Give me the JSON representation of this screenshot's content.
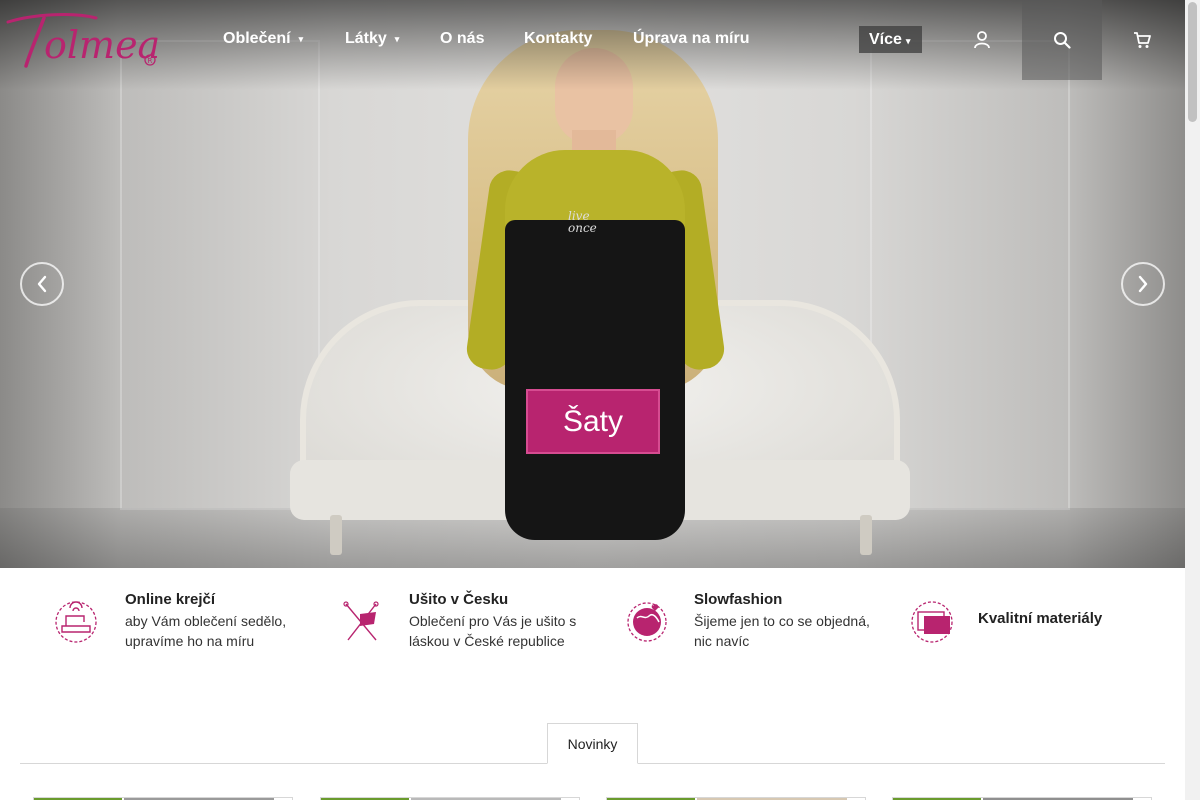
{
  "header": {
    "logo_text": "Tolmea",
    "nav": [
      {
        "label": "Oblečení",
        "has_dropdown": true
      },
      {
        "label": "Látky",
        "has_dropdown": true
      },
      {
        "label": "O nás",
        "has_dropdown": false
      },
      {
        "label": "Kontakty",
        "has_dropdown": false
      },
      {
        "label": "Úprava na míru",
        "has_dropdown": false
      }
    ],
    "more_label": "Více",
    "icons": [
      "user-icon",
      "search-icon",
      "cart-icon"
    ]
  },
  "hero": {
    "cta_label": "Šaty",
    "dress_print": [
      "live",
      "once"
    ],
    "prev_icon": "chevron-left-icon",
    "next_icon": "chevron-right-icon"
  },
  "features": [
    {
      "icon": "sewing-machine-icon",
      "title": "Online krejčí",
      "desc": "aby Vám oblečení sedělo, upravíme ho na míru"
    },
    {
      "icon": "flag-icon",
      "title": "Ušito v Česku",
      "desc": "Oblečení pro Vás je ušito s láskou v České republice"
    },
    {
      "icon": "globe-heart-icon",
      "title": "Slowfashion",
      "desc": "Šijeme jen to co se objedná, nic navíc"
    },
    {
      "icon": "fabric-icon",
      "title": "Kvalitní materiály",
      "desc": ""
    }
  ],
  "tabs": [
    {
      "label": "Novinky",
      "active": true
    }
  ],
  "colors": {
    "brand": "#b8246f",
    "accent_green": "#6a9b2d"
  }
}
